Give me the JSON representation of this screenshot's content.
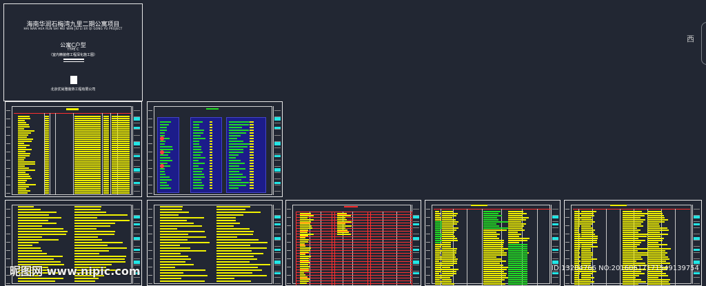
{
  "cover": {
    "title_cn": "海南华润石梅湾九里二期公寓项目",
    "title_en": "HAI NAN HUA RUN SHI MEI WAN JIU LI ER QI GONG YU PROJECT",
    "type_cn": "公寓C户型",
    "type_en": "TYPE  C",
    "subtitle": "（室内精装修工程深化施工图）",
    "company": "北京优尚雅装饰工程有限公司"
  },
  "viewcube": {
    "west_label": "西"
  },
  "watermark": {
    "site": "昵图网 www.nipic.com",
    "id_line": "ID:13204766 NO:20160617171549139754"
  },
  "colors": {
    "background": "#222733",
    "highlight_yellow": "#f2f200",
    "accent_green": "#22dd22",
    "accent_red": "#ff3030",
    "titleblock_cyan": "#22e6e6"
  }
}
